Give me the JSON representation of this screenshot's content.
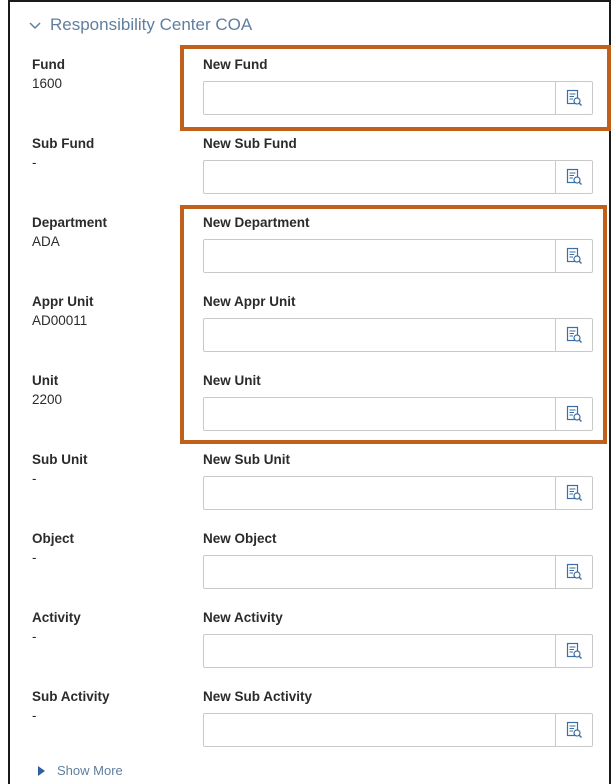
{
  "section": {
    "title": "Responsibility Center COA"
  },
  "rows": [
    {
      "label": "Fund",
      "value": "1600",
      "field_label": "New Fund",
      "field_value": ""
    },
    {
      "label": "Sub Fund",
      "value": "-",
      "field_label": "New Sub Fund",
      "field_value": ""
    },
    {
      "label": "Department",
      "value": "ADA",
      "field_label": "New Department",
      "field_value": ""
    },
    {
      "label": "Appr Unit",
      "value": "AD00011",
      "field_label": "New Appr Unit",
      "field_value": ""
    },
    {
      "label": "Unit",
      "value": "2200",
      "field_label": "New Unit",
      "field_value": ""
    },
    {
      "label": "Sub Unit",
      "value": "-",
      "field_label": "New Sub Unit",
      "field_value": ""
    },
    {
      "label": "Object",
      "value": "-",
      "field_label": "New Object",
      "field_value": ""
    },
    {
      "label": "Activity",
      "value": "-",
      "field_label": "New Activity",
      "field_value": ""
    },
    {
      "label": "Sub Activity",
      "value": "-",
      "field_label": "New Sub Activity",
      "field_value": ""
    }
  ],
  "footer": {
    "show_more_label": "Show More"
  },
  "icons": {
    "section_toggle": "chevron-down-icon",
    "lookup": "lookup-search-icon",
    "show_more": "caret-right-icon"
  },
  "colors": {
    "section_title": "#5f7f9e",
    "highlight_border": "#c0601a",
    "lookup_icon": "#3a6ea5"
  }
}
